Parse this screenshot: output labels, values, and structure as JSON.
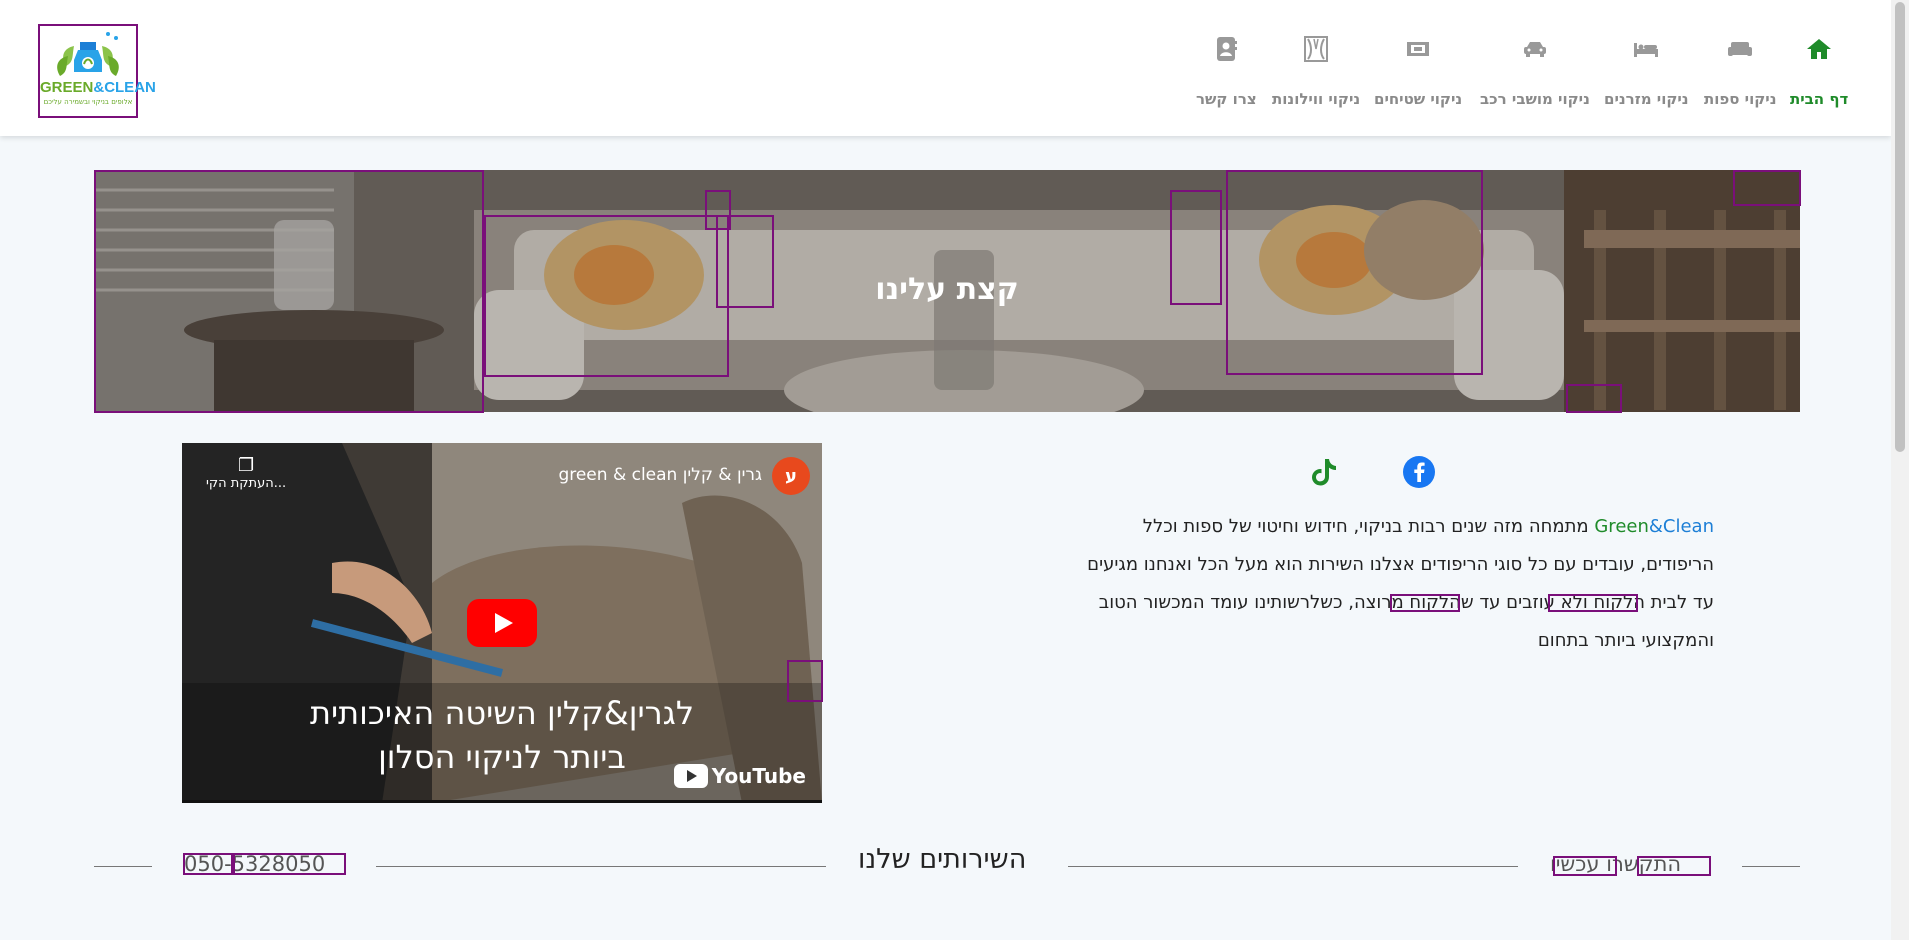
{
  "header": {
    "logo": {
      "line1": "GREEN",
      "amp": "&",
      "line2": "CLEAN",
      "tagline": "אלופים בניקוי ובשמירה עליכם"
    },
    "nav": [
      {
        "label": "דף הבית",
        "icon": "home-icon",
        "active": true
      },
      {
        "label": "ניקוי ספות",
        "icon": "sofa-icon"
      },
      {
        "label": "ניקוי מזרנים",
        "icon": "bed-icon"
      },
      {
        "label": "ניקוי מושבי רכב",
        "icon": "car-icon"
      },
      {
        "label": "ניקוי שטיחים",
        "icon": "rug-icon"
      },
      {
        "label": "ניקוי ווילונות",
        "icon": "curtain-icon"
      },
      {
        "label": "צרו קשר",
        "icon": "contact-book-icon"
      }
    ]
  },
  "hero": {
    "title": "קצת עלינו"
  },
  "social": {
    "facebook": "facebook-icon",
    "tiktok": "tiktok-icon"
  },
  "about": {
    "brand_green": "Green",
    "brand_blue": "&Clean",
    "line1": " מתמחה מזה שנים רבות בניקוי, חידוש וחיטוי של ספות וכלל",
    "line2": "הריפודים, עובדים עם כל סוגי הריפודים אצלנו השירות הוא מעל הכל ואנחנו מגיעים",
    "line3": "עד לבית הלקוח ולא עוזבים עד שהלקוח מרוצה, כשלרשותינו עומד המכשור הטוב",
    "line4": "והמקצועי ביותר בתחום"
  },
  "video": {
    "channel_name": "גרין & קלין green & clean",
    "channel_badge": "ע",
    "copy_link": "העתקת הקי...",
    "caption_line1": "לגרין&קלין השיטה האיכותית",
    "caption_line2": "ביותר לניקוי הסלון",
    "youtube_label": "YouTube"
  },
  "services": {
    "title": "השירותים שלנו"
  },
  "phone": "050-5328050",
  "call_now": "התקשרו עכשיו",
  "colors": {
    "brand_green": "#1f8b2a",
    "brand_blue": "#1d7fd6",
    "highlight_box": "#7a0f7a"
  }
}
